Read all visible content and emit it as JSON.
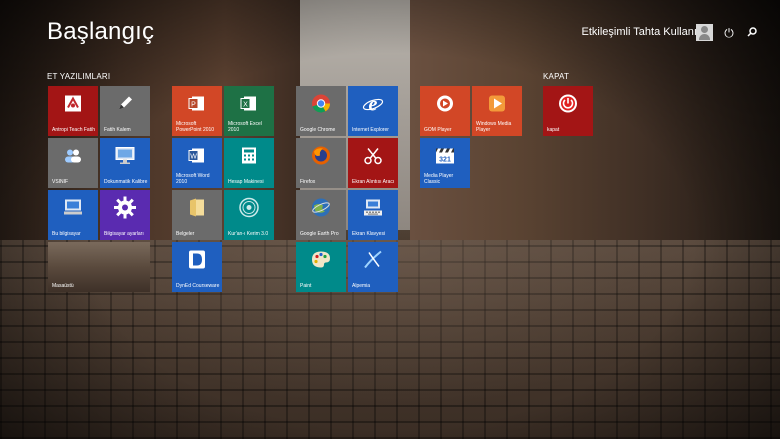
{
  "header": {
    "title": "Başlangıç",
    "user_name": "Etkileşimli Tahta Kullanıcısı"
  },
  "groups": {
    "group1": "ET YAZILIMLARI",
    "group2": "KAPAT"
  },
  "tiles": {
    "antropi": {
      "label": "Antropi Teach Fatih",
      "color": "#a31515"
    },
    "fatih_kalem": {
      "label": "Fatih Kalem",
      "color": "#6b6b6b"
    },
    "vsinif": {
      "label": "VSINIF",
      "color": "#6b6b6b"
    },
    "dokunmatik": {
      "label": "Dokunmatik Kalibre",
      "color": "#1f5fbf"
    },
    "bu_bilgisayar": {
      "label": "Bu bilgisayar",
      "color": "#1f5fbf"
    },
    "bilgisayar_ayarlari": {
      "label": "Bilgisayar ayarları",
      "color": "#5a2bb0"
    },
    "masaustu": {
      "label": "Masaüstü"
    },
    "powerpoint": {
      "label": "Microsoft PowerPoint 2010",
      "color": "#d24726"
    },
    "excel": {
      "label": "Microsoft Excel 2010",
      "color": "#1e7145"
    },
    "word": {
      "label": "Microsoft Word 2010",
      "color": "#1f5fbf"
    },
    "hesap_makinesi": {
      "label": "Hesap Makinesi",
      "color": "#008a8a"
    },
    "belgeler": {
      "label": "Belgeler",
      "color": "#6b6b6b"
    },
    "kurani_kerim": {
      "label": "Kur'an-ı Kerim 3.0",
      "color": "#008a8a"
    },
    "dynedpro": {
      "label": "DynEd Courseware",
      "color": "#1f5fbf"
    },
    "chrome": {
      "label": "Google Chrome",
      "color": "#6b6b6b"
    },
    "ie": {
      "label": "Internet Explorer",
      "color": "#1f5fbf"
    },
    "firefox": {
      "label": "Firefox",
      "color": "#6b6b6b"
    },
    "ekran_alintisi": {
      "label": "Ekran Alıntısı Aracı",
      "color": "#a31515"
    },
    "google_earth": {
      "label": "Google Earth Pro",
      "color": "#6b6b6b"
    },
    "ekran_klavyesi": {
      "label": "Ekran Klavyesi",
      "color": "#1f5fbf"
    },
    "paint": {
      "label": "Paint",
      "color": "#008a8a"
    },
    "alpemia": {
      "label": "Alpemia",
      "color": "#1f5fbf"
    },
    "gom_player": {
      "label": "GOM Player",
      "color": "#d24726"
    },
    "wmp": {
      "label": "Windows Media Player",
      "color": "#d24726"
    },
    "mpc": {
      "label": "Media Player Classic",
      "color": "#1f5fbf"
    },
    "kapat": {
      "label": "kapat",
      "color": "#a31515"
    }
  }
}
